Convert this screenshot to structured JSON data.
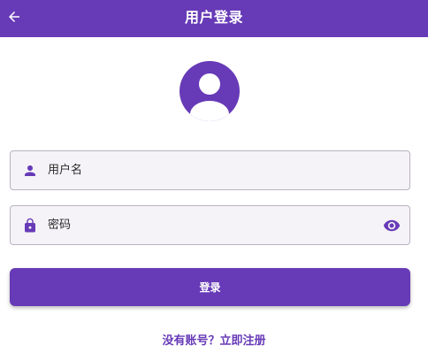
{
  "appbar": {
    "title": "用户登录",
    "back_icon": "arrow-left-icon"
  },
  "avatar": {
    "icon": "account-circle-icon"
  },
  "username": {
    "placeholder": "用户名",
    "value": "",
    "icon": "person-icon"
  },
  "password": {
    "placeholder": "密码",
    "value": "",
    "icon": "lock-icon",
    "toggle_icon": "eye-icon"
  },
  "login_button": {
    "label": "登录"
  },
  "register_link": {
    "label": "没有账号？立即注册"
  },
  "colors": {
    "primary": "#673ab7",
    "field_bg": "#f5f3f7",
    "field_border": "#b9b2c4",
    "text": "#2a2a2a"
  }
}
